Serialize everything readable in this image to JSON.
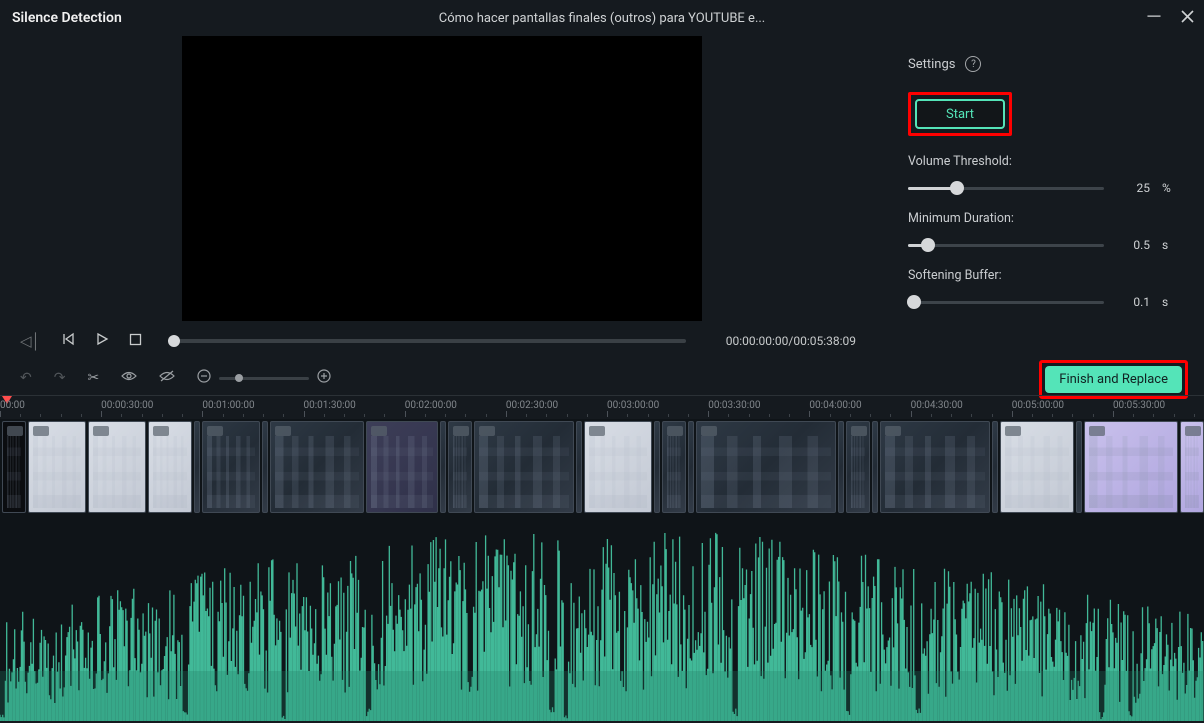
{
  "titlebar": {
    "title": "Silence Detection",
    "subtitle": "Cómo hacer pantallas finales (outros) para YOUTUBE e..."
  },
  "transport": {
    "timecode": "00:00:00:00/00:05:38:09"
  },
  "settings": {
    "header": "Settings",
    "start_label": "Start",
    "volume_threshold": {
      "label": "Volume Threshold:",
      "value": "25",
      "unit": "%",
      "percent": 25
    },
    "minimum_duration": {
      "label": "Minimum Duration:",
      "value": "0.5",
      "unit": "s",
      "percent": 10
    },
    "softening_buffer": {
      "label": "Softening Buffer:",
      "value": "0.1",
      "unit": "s",
      "percent": 3
    }
  },
  "toolbar": {
    "finish_label": "Finish and Replace"
  },
  "ruler": {
    "labels": [
      "00:00",
      "00:00:30:00",
      "00:01:00:00",
      "00:01:30:00",
      "00:02:00:00",
      "00:02:30:00",
      "00:03:00:00",
      "00:03:30:00",
      "00:04:00:00",
      "00:04:30:00",
      "00:05:00:00",
      "00:05:30:00"
    ]
  },
  "colors": {
    "accent": "#54e4b8",
    "highlight": "#ff0000",
    "wave": "#46c8a3",
    "wave_dark": "#1f7d63"
  }
}
